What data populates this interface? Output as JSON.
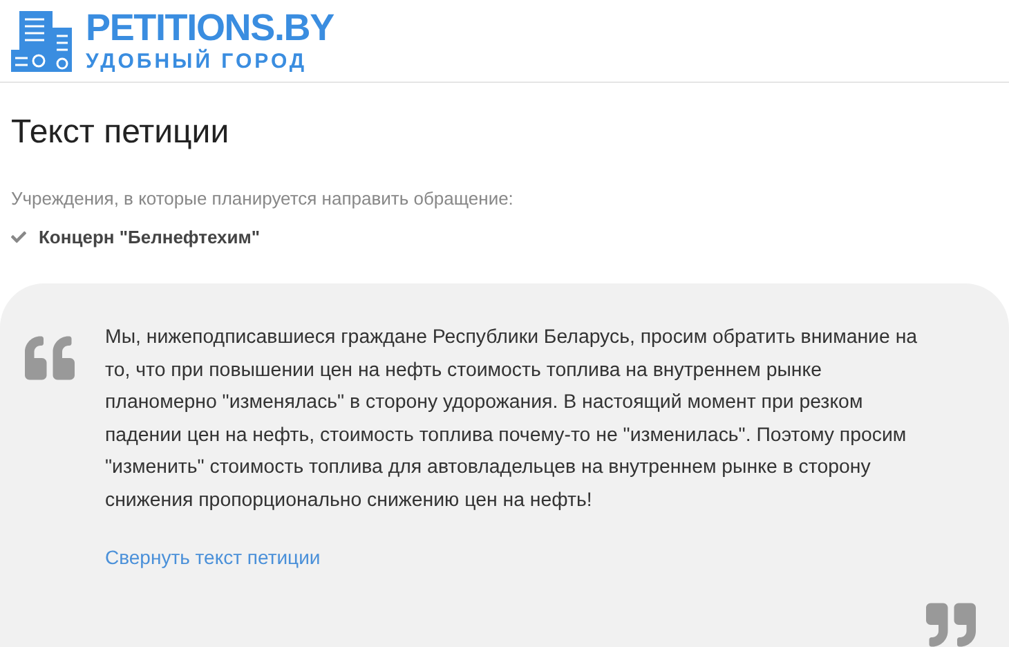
{
  "logo": {
    "title": "PETITIONS.BY",
    "subtitle": "УДОБНЫЙ ГОРОД"
  },
  "page_title": "Текст петиции",
  "recipients": {
    "label": "Учреждения, в которые планируется направить обращение:",
    "items": [
      "Концерн \"Белнефтехим\""
    ]
  },
  "petition": {
    "text": "Мы, нижеподписавшиеся граждане Республики Беларусь, просим обратить внимание на то, что при повышении цен на нефть стоимость топлива на внутреннем рынке планомерно \"изменялась\" в сторону удорожания. В настоящий момент при резком падении цен на нефть, стоимость топлива почему-то не \"изменилась\". Поэтому просим \"изменить\" стоимость топлива для автовладельцев на внутреннем рынке в сторону снижения пропорционально снижению цен на нефть!",
    "collapse_link": "Свернуть текст петиции"
  }
}
